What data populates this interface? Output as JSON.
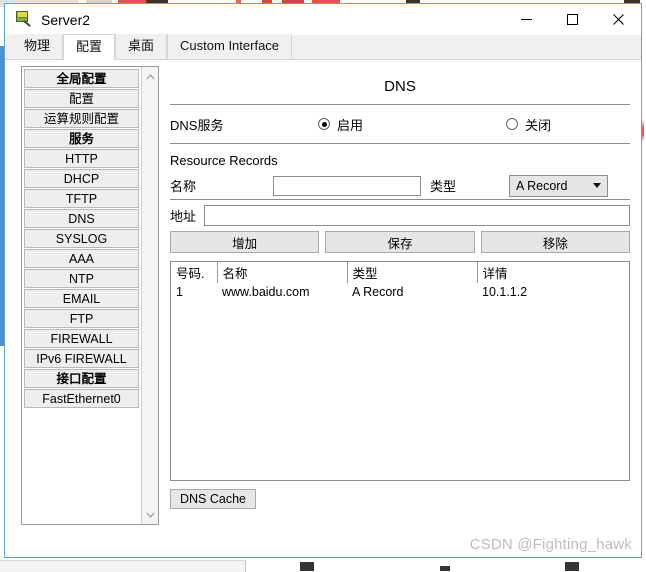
{
  "window": {
    "title": "Server2",
    "icon": "packet-tracer-server-icon",
    "controls": {
      "minimize": "minimize-icon",
      "maximize": "maximize-icon",
      "close": "close-icon"
    }
  },
  "tabs": [
    {
      "label": "物理",
      "active": false
    },
    {
      "label": "配置",
      "active": true
    },
    {
      "label": "桌面",
      "active": false
    },
    {
      "label": "Custom Interface",
      "active": false
    }
  ],
  "sidebar": {
    "items": [
      {
        "label": "全局配置",
        "header": true
      },
      {
        "label": "配置",
        "header": false
      },
      {
        "label": "运算规则配置",
        "header": false
      },
      {
        "label": "服务",
        "header": true
      },
      {
        "label": "HTTP",
        "header": false
      },
      {
        "label": "DHCP",
        "header": false
      },
      {
        "label": "TFTP",
        "header": false
      },
      {
        "label": "DNS",
        "header": false
      },
      {
        "label": "SYSLOG",
        "header": false
      },
      {
        "label": "AAA",
        "header": false
      },
      {
        "label": "NTP",
        "header": false
      },
      {
        "label": "EMAIL",
        "header": false
      },
      {
        "label": "FTP",
        "header": false
      },
      {
        "label": "FIREWALL",
        "header": false
      },
      {
        "label": "IPv6 FIREWALL",
        "header": false
      },
      {
        "label": "接口配置",
        "header": true
      },
      {
        "label": "FastEthernet0",
        "header": false
      }
    ],
    "scrollbar": {
      "up": "chevron-up-icon",
      "down": "chevron-down-icon"
    }
  },
  "main": {
    "panel_title": "DNS",
    "service": {
      "label": "DNS服务",
      "on_label": "启用",
      "off_label": "关闭",
      "selected": "on"
    },
    "resource_records": {
      "section_label": "Resource Records",
      "name_label": "名称",
      "name_value": "",
      "type_label": "类型",
      "type_value": "A Record",
      "address_label": "地址",
      "address_value": ""
    },
    "buttons": {
      "add": "增加",
      "save": "保存",
      "remove": "移除"
    },
    "table": {
      "columns": [
        "号码.",
        "名称",
        "类型",
        "详情"
      ],
      "rows": [
        [
          "1",
          "www.baidu.com",
          "A Record",
          "10.1.1.2"
        ]
      ]
    },
    "cache_button": "DNS Cache"
  },
  "watermark": "CSDN @Fighting_hawk"
}
